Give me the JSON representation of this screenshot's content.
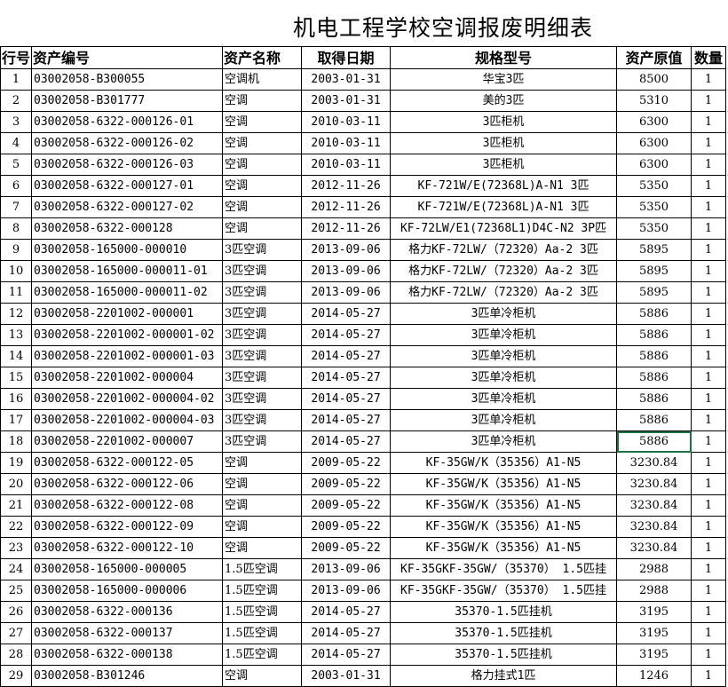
{
  "title": "机电工程学校空调报废明细表",
  "headers": [
    "行号",
    "资产编号",
    "资产名称",
    "取得日期",
    "规格型号",
    "资产原值",
    "数量"
  ],
  "rows": [
    [
      "1",
      "03002058-B300055",
      "空调机",
      "2003-01-31",
      "华宝3匹",
      "8500",
      "1"
    ],
    [
      "2",
      "03002058-B301777",
      "空调",
      "2003-01-31",
      "美的3匹",
      "5310",
      "1"
    ],
    [
      "3",
      "03002058-6322-000126-01",
      "空调",
      "2010-03-11",
      "3匹柜机",
      "6300",
      "1"
    ],
    [
      "4",
      "03002058-6322-000126-02",
      "空调",
      "2010-03-11",
      "3匹柜机",
      "6300",
      "1"
    ],
    [
      "5",
      "03002058-6322-000126-03",
      "空调",
      "2010-03-11",
      "3匹柜机",
      "6300",
      "1"
    ],
    [
      "6",
      "03002058-6322-000127-01",
      "空调",
      "2012-11-26",
      "KF-721W/E(72368L)A-N1 3匹",
      "5350",
      "1"
    ],
    [
      "7",
      "03002058-6322-000127-02",
      "空调",
      "2012-11-26",
      "KF-721W/E(72368L)A-N1 3匹",
      "5350",
      "1"
    ],
    [
      "8",
      "03002058-6322-000128",
      "空调",
      "2012-11-26",
      "KF-72LW/E1(72368L1)D4C-N2  3P匹",
      "5350",
      "1"
    ],
    [
      "9",
      "03002058-165000-000010",
      "3匹空调",
      "2013-09-06",
      "格力KF-72LW/（72320）Aa-2 3匹",
      "5895",
      "1"
    ],
    [
      "10",
      "03002058-165000-000011-01",
      "3匹空调",
      "2013-09-06",
      "格力KF-72LW/（72320）Aa-2 3匹",
      "5895",
      "1"
    ],
    [
      "11",
      "03002058-165000-000011-02",
      "3匹空调",
      "2013-09-06",
      "格力KF-72LW/（72320）Aa-2 3匹",
      "5895",
      "1"
    ],
    [
      "12",
      "03002058-2201002-000001",
      "3匹空调",
      "2014-05-27",
      "3匹单冷柜机",
      "5886",
      "1"
    ],
    [
      "13",
      "03002058-2201002-000001-02",
      "3匹空调",
      "2014-05-27",
      "3匹单冷柜机",
      "5886",
      "1"
    ],
    [
      "14",
      "03002058-2201002-000001-03",
      "3匹空调",
      "2014-05-27",
      "3匹单冷柜机",
      "5886",
      "1"
    ],
    [
      "15",
      "03002058-2201002-000004",
      "3匹空调",
      "2014-05-27",
      "3匹单冷柜机",
      "5886",
      "1"
    ],
    [
      "16",
      "03002058-2201002-000004-02",
      "3匹空调",
      "2014-05-27",
      "3匹单冷柜机",
      "5886",
      "1"
    ],
    [
      "17",
      "03002058-2201002-000004-03",
      "3匹空调",
      "2014-05-27",
      "3匹单冷柜机",
      "5886",
      "1"
    ],
    [
      "18",
      "03002058-2201002-000007",
      "3匹空调",
      "2014-05-27",
      "3匹单冷柜机",
      "5886",
      "1"
    ],
    [
      "19",
      "03002058-6322-000122-05",
      "空调",
      "2009-05-22",
      "KF-35GW/K（35356）A1-N5",
      "3230.84",
      "1"
    ],
    [
      "20",
      "03002058-6322-000122-06",
      "空调",
      "2009-05-22",
      "KF-35GW/K（35356）A1-N5",
      "3230.84",
      "1"
    ],
    [
      "21",
      "03002058-6322-000122-08",
      "空调",
      "2009-05-22",
      "KF-35GW/K（35356）A1-N5",
      "3230.84",
      "1"
    ],
    [
      "22",
      "03002058-6322-000122-09",
      "空调",
      "2009-05-22",
      "KF-35GW/K（35356）A1-N5",
      "3230.84",
      "1"
    ],
    [
      "23",
      "03002058-6322-000122-10",
      "空调",
      "2009-05-22",
      "KF-35GW/K（35356）A1-N5",
      "3230.84",
      "1"
    ],
    [
      "24",
      "03002058-165000-000005",
      "1.5匹空调",
      "2013-09-06",
      "KF-35GKF-35GW/（35370） 1.5匹挂",
      "2988",
      "1"
    ],
    [
      "25",
      "03002058-165000-000006",
      "1.5匹空调",
      "2013-09-06",
      "KF-35GKF-35GW/（35370） 1.5匹挂",
      "2988",
      "1"
    ],
    [
      "26",
      "03002058-6322-000136",
      "1.5匹空调",
      "2014-05-27",
      "35370-1.5匹挂机",
      "3195",
      "1"
    ],
    [
      "27",
      "03002058-6322-000137",
      "1.5匹空调",
      "2014-05-27",
      "35370-1.5匹挂机",
      "3195",
      "1"
    ],
    [
      "28",
      "03002058-6322-000138",
      "1.5匹空调",
      "2014-05-27",
      "35370-1.5匹挂机",
      "3195",
      "1"
    ],
    [
      "29",
      "03002058-B301246",
      "空调",
      "2003-01-31",
      "格力挂式1匹",
      "1246",
      "1"
    ]
  ],
  "selected_cell": {
    "row": 18,
    "column": "资产原值"
  }
}
